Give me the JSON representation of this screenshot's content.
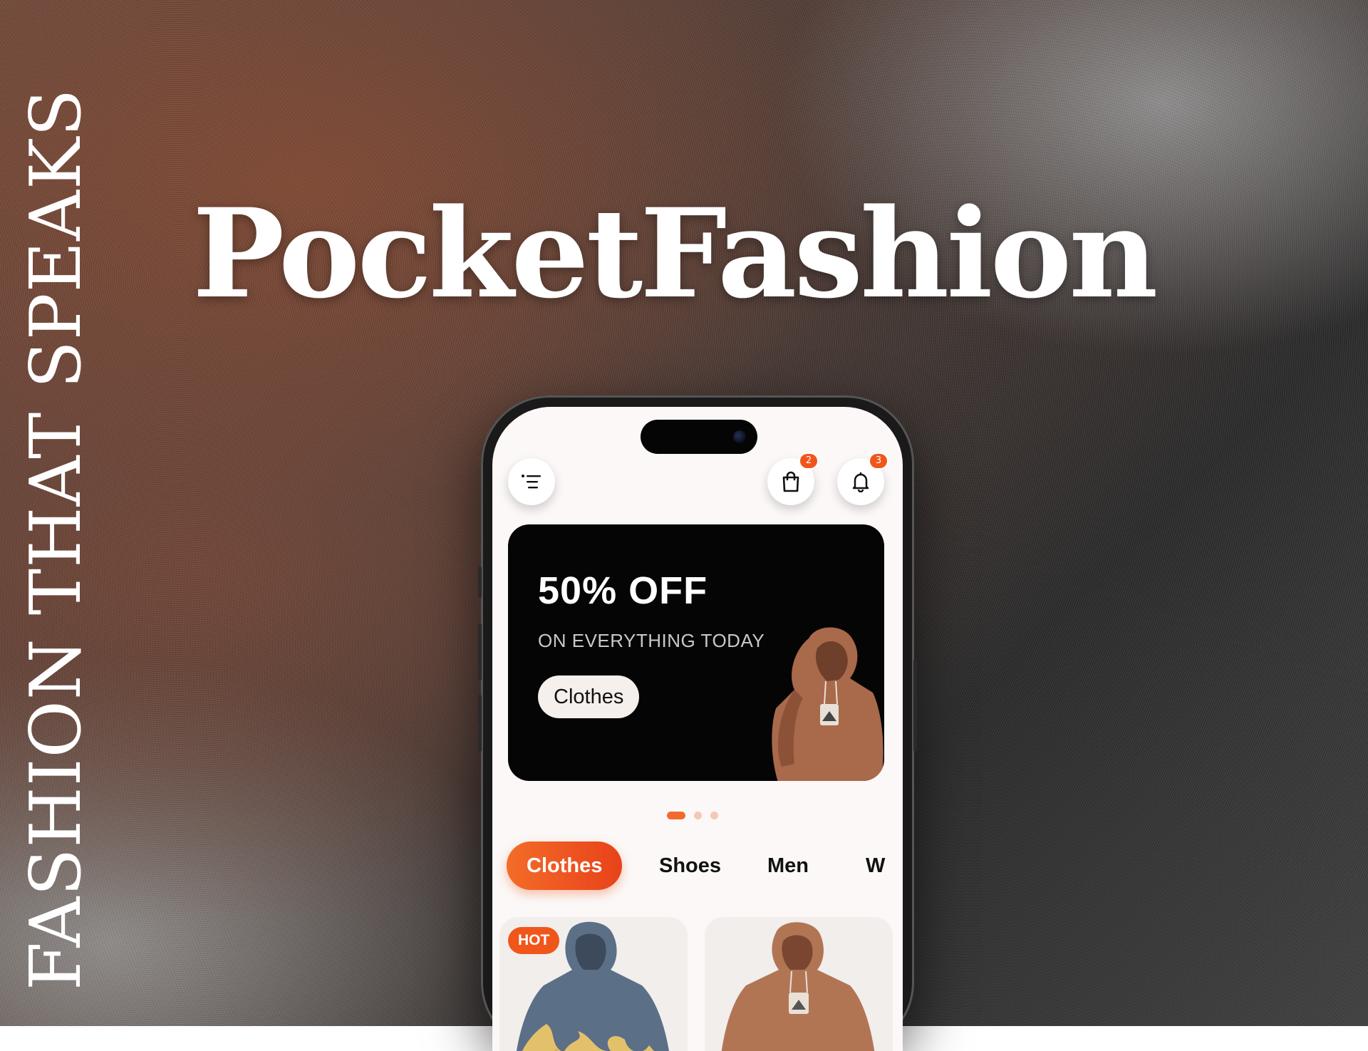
{
  "hero": {
    "tagline": "FASHION THAT SPEAKS",
    "brand": "PocketFashion"
  },
  "app": {
    "header": {
      "menu_icon": "menu-lines-icon",
      "bag_icon": "shopping-bag-icon",
      "bag_badge": "2",
      "bell_icon": "bell-icon",
      "bell_badge": "3"
    },
    "promo": {
      "title": "50% OFF",
      "subtitle": "ON EVERYTHING TODAY",
      "button_label": "Clothes"
    },
    "carousel": {
      "count": 3,
      "active_index": 0
    },
    "categories": [
      {
        "label": "Clothes",
        "active": true
      },
      {
        "label": "Shoes",
        "active": false
      },
      {
        "label": "Men",
        "active": false
      },
      {
        "label": "W",
        "active": false
      }
    ],
    "products": [
      {
        "badge": "HOT",
        "image": "blue-flame-hoodie"
      },
      {
        "badge": "",
        "image": "brown-hoodie"
      }
    ]
  },
  "colors": {
    "accent": "#f0561b",
    "promo_bg": "#050505",
    "screen_bg": "#fbf8f7"
  }
}
